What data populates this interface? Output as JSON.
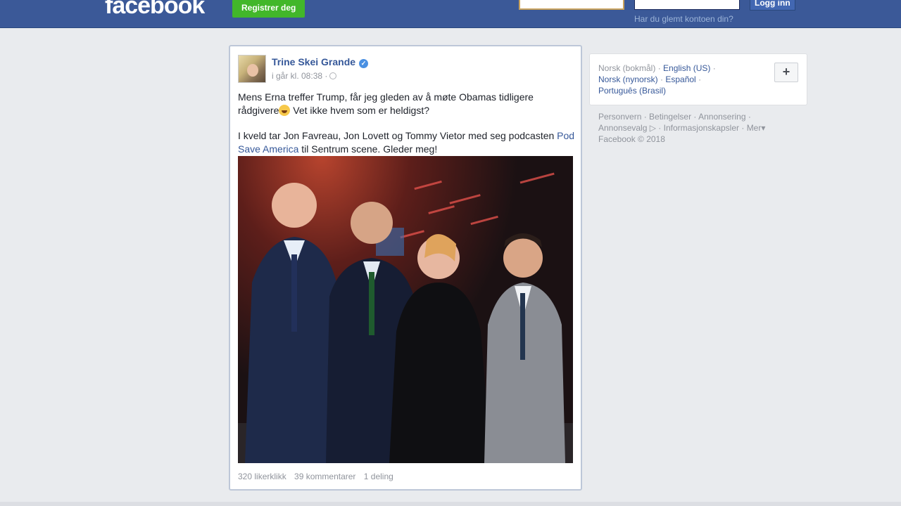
{
  "header": {
    "logo": "facebook",
    "register_label": "Registrer deg",
    "login_label": "Logg inn",
    "forgot_label": "Har du glemt kontoen din?",
    "email_value": "",
    "password_value": ""
  },
  "post": {
    "author": "Trine Skei Grande",
    "timestamp": "i går kl. 08:38 ·",
    "text1_a": "Mens Erna treffer Trump, får jeg gleden av å møte Obamas tidligere rådgivere",
    "text1_b": " Vet ikke hvem som er heldigst?",
    "text2_a": "I kveld tar Jon Favreau, Jon Lovett og Tommy Vietor med seg podcasten ",
    "text2_link": "Pod Save America",
    "text2_b": " til Sentrum scene. Gleder meg!",
    "likes": "320 likerklikk",
    "comments": "39 kommentarer",
    "shares": "1 deling"
  },
  "languages": {
    "current": "Norsk (bokmål)",
    "sep": " · ",
    "items": [
      "English (US)",
      "Norsk (nynorsk)",
      "Español",
      "Português (Brasil)"
    ],
    "plus_label": "+"
  },
  "footer": {
    "links": [
      "Personvern",
      "Betingelser",
      "Annonsering",
      "Annonsevalg",
      "Informasjonskapsler",
      "Mer"
    ],
    "copyright": "Facebook © 2018"
  },
  "colors": {
    "brand": "#3b5998",
    "link": "#365899",
    "green": "#42b72a"
  }
}
